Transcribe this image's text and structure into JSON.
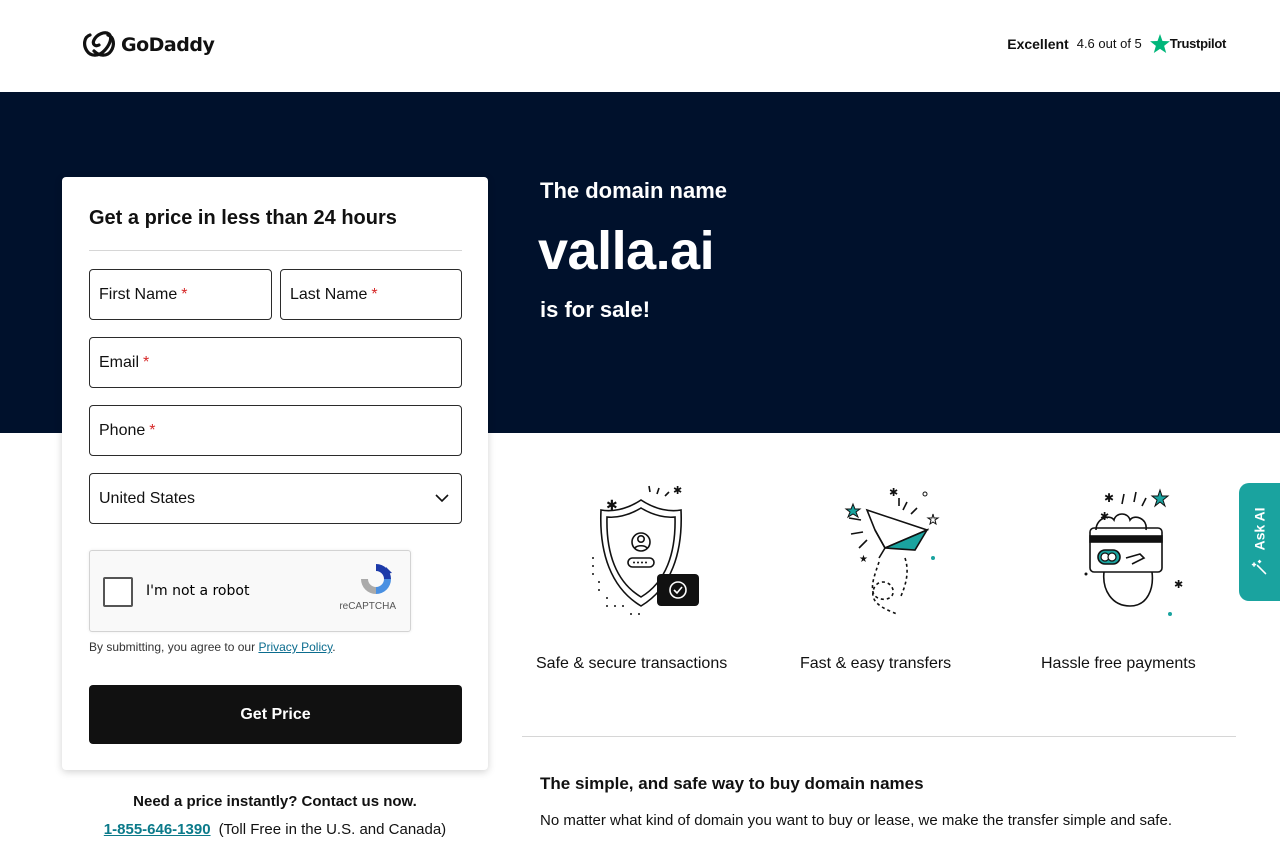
{
  "header": {
    "logo_text": "GoDaddy",
    "rating_label": "Excellent",
    "rating_score": "4.6 out of 5",
    "rating_source": "Trustpilot"
  },
  "hero": {
    "line1": "The domain name",
    "domain": "valla.ai",
    "line2": "is for sale!"
  },
  "form": {
    "title": "Get a price in less than 24 hours",
    "first_name_label": "First Name",
    "last_name_label": "Last Name",
    "email_label": "Email",
    "phone_label": "Phone",
    "required_marker": "*",
    "country_value": "United States",
    "captcha_label": "I'm not a robot",
    "captcha_brand": "reCAPTCHA",
    "consent_prefix": "By submitting, you agree to our ",
    "consent_link": "Privacy Policy",
    "consent_suffix": ".",
    "submit_label": "Get Price"
  },
  "contact": {
    "title": "Need a price instantly? Contact us now.",
    "phone": "1-855-646-1390",
    "phone_note": "(Toll Free in the U.S. and Canada)"
  },
  "features": [
    {
      "label": "Safe & secure transactions",
      "icon": "shield-icon"
    },
    {
      "label": "Fast & easy transfers",
      "icon": "paper-plane-icon"
    },
    {
      "label": "Hassle free payments",
      "icon": "credit-card-icon"
    }
  ],
  "info": {
    "title": "The simple, and safe way to buy domain names",
    "body": "No matter what kind of domain you want to buy or lease, we make the transfer simple and safe."
  },
  "ask_ai": {
    "label": "Ask AI"
  },
  "colors": {
    "hero_bg": "#00112c",
    "button_bg": "#111111",
    "accent_teal": "#1aa39f",
    "trustpilot_green": "#00b67a",
    "required_red": "#d62828"
  }
}
